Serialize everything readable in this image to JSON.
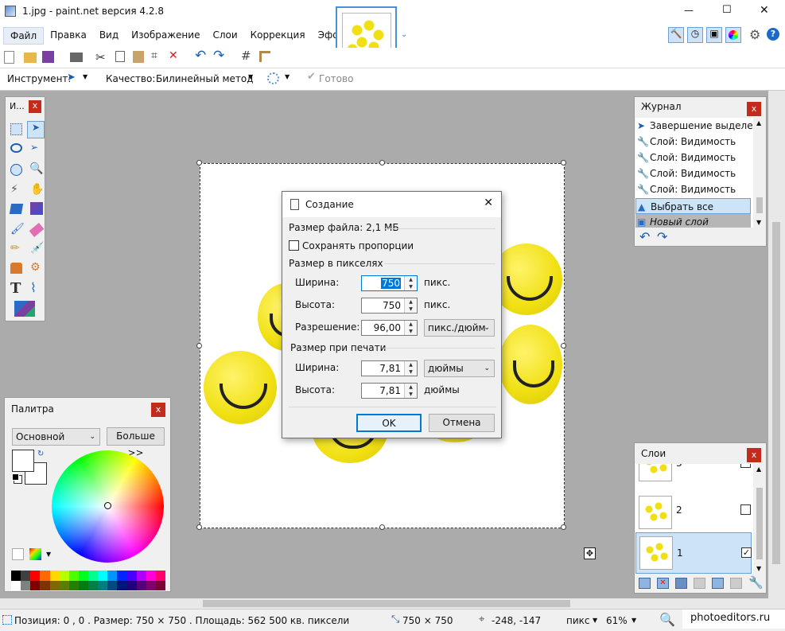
{
  "window": {
    "title": "1.jpg - paint.net версия 4.2.8",
    "min": "—",
    "max": "☐",
    "close": "✕"
  },
  "menu": [
    "Файл",
    "Правка",
    "Вид",
    "Изображение",
    "Слои",
    "Коррекция",
    "Эффекты"
  ],
  "toolbar2": {
    "tool_label": "Инструмент:",
    "quality_label": "Качество:",
    "quality_value": "Билинейный метод",
    "done_label": "Готово"
  },
  "tools_panel": {
    "title": "И...",
    "close": "x"
  },
  "history": {
    "title": "Журнал",
    "close": "x",
    "items": [
      "Завершение выделения",
      "Слой: Видимость",
      "Слой: Видимость",
      "Слой: Видимость",
      "Слой: Видимость",
      "Выбрать все",
      "Новый слой"
    ]
  },
  "palette": {
    "title": "Палитра",
    "close": "x",
    "mode": "Основной",
    "more_button": "Больше >>",
    "swatches": [
      "#000000",
      "#404040",
      "#ff0000",
      "#ff6a00",
      "#ffd800",
      "#b6ff00",
      "#4cff00",
      "#00ff21",
      "#00ff90",
      "#00ffff",
      "#0094ff",
      "#0026ff",
      "#4800ff",
      "#b200ff",
      "#ff00dc",
      "#ff006e",
      "#ffffff",
      "#808080",
      "#7f0000",
      "#7f3300",
      "#7f6a00",
      "#5b7f00",
      "#267f00",
      "#007f0e",
      "#007f46",
      "#007f7f",
      "#004a7f",
      "#00137f",
      "#21007f",
      "#57007f",
      "#7f006e",
      "#7f0037"
    ]
  },
  "layers": {
    "title": "Слои",
    "close": "x",
    "items": [
      {
        "name": "3",
        "checked": false
      },
      {
        "name": "2",
        "checked": false
      },
      {
        "name": "1",
        "checked": true
      }
    ]
  },
  "dialog": {
    "title": "Создание",
    "close": "✕",
    "file_size": "Размер файла: 2,1 МБ",
    "keep_ratio": "Сохранять пропорции",
    "pixel_section": "Размер в пикселях",
    "width_label": "Ширина:",
    "width_value": "750",
    "width_unit": "пикс.",
    "height_label": "Высота:",
    "height_value": "750",
    "height_unit": "пикс.",
    "resolution_label": "Разрешение:",
    "resolution_value": "96,00",
    "resolution_unit": "пикс./дюйм",
    "print_section": "Размер при печати",
    "print_width_label": "Ширина:",
    "print_width_value": "7,81",
    "print_width_unit": "дюймы",
    "print_height_label": "Высота:",
    "print_height_value": "7,81",
    "print_height_unit": "дюймы",
    "ok": "OK",
    "cancel": "Отмена"
  },
  "status": {
    "info": "Позиция: 0 , 0 . Размер: 750  × 750 . Площадь: 562 500 кв. пиксели",
    "image_size": "750 × 750",
    "cursor": "-248, -147",
    "unit": "пикс",
    "zoom": "61%",
    "watermark": "photoeditors.ru"
  }
}
